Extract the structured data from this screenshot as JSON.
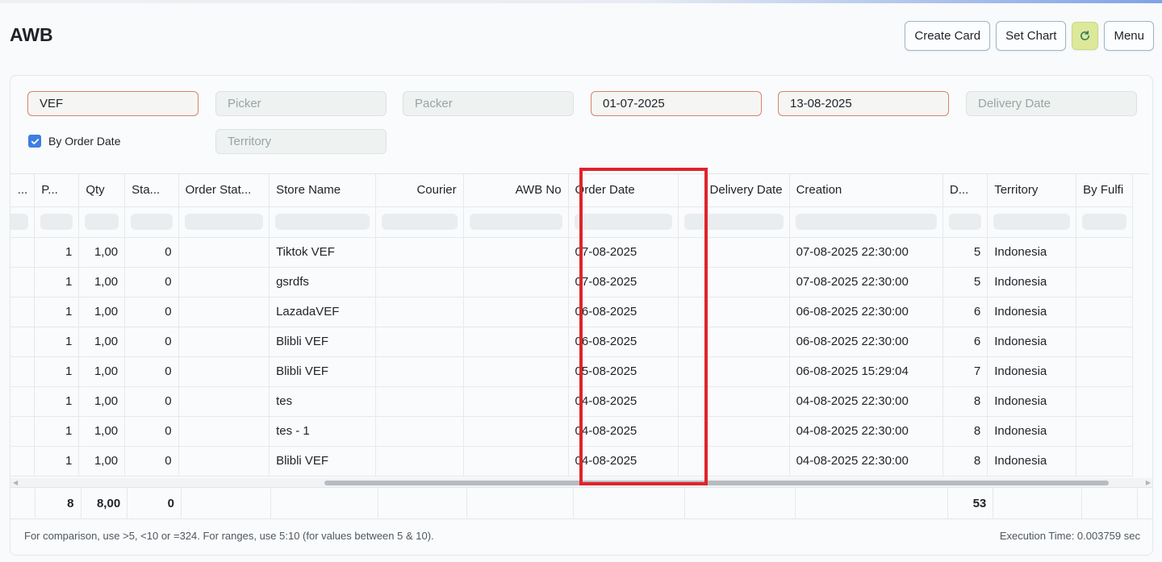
{
  "page": {
    "title": "AWB",
    "actions": {
      "create_card": "Create Card",
      "set_chart": "Set Chart",
      "refresh_icon": "refresh-icon",
      "menu": "Menu"
    }
  },
  "filters": {
    "company": {
      "value": "VEF",
      "placeholder": ""
    },
    "picker": {
      "value": "",
      "placeholder": "Picker"
    },
    "packer": {
      "value": "",
      "placeholder": "Packer"
    },
    "from_date": {
      "value": "01-07-2025",
      "placeholder": ""
    },
    "to_date": {
      "value": "13-08-2025",
      "placeholder": ""
    },
    "delivery_date": {
      "value": "",
      "placeholder": "Delivery Date"
    },
    "by_order_date": {
      "label": "By Order Date",
      "checked": true
    },
    "territory": {
      "value": "",
      "placeholder": "Territory"
    }
  },
  "table": {
    "columns": [
      {
        "label": "...",
        "align": "right"
      },
      {
        "label": "P...",
        "align": "left"
      },
      {
        "label": "Qty",
        "align": "left"
      },
      {
        "label": "Sta...",
        "align": "left"
      },
      {
        "label": "Order Stat...",
        "align": "left"
      },
      {
        "label": "Store Name",
        "align": "left"
      },
      {
        "label": "Courier",
        "align": "right"
      },
      {
        "label": "AWB No",
        "align": "right"
      },
      {
        "label": "Order Date",
        "align": "left"
      },
      {
        "label": "Delivery Date",
        "align": "right"
      },
      {
        "label": "Creation",
        "align": "left"
      },
      {
        "label": "D...",
        "align": "left"
      },
      {
        "label": "Territory",
        "align": "left"
      },
      {
        "label": "By Fulfi",
        "align": "left"
      }
    ],
    "rows": [
      [
        "",
        "1",
        "1,00",
        "0",
        "",
        "Tiktok VEF",
        "",
        "",
        "07-08-2025",
        "",
        "07-08-2025 22:30:00",
        "5",
        "Indonesia",
        ""
      ],
      [
        "",
        "1",
        "1,00",
        "0",
        "",
        "gsrdfs",
        "",
        "",
        "07-08-2025",
        "",
        "07-08-2025 22:30:00",
        "5",
        "Indonesia",
        ""
      ],
      [
        "",
        "1",
        "1,00",
        "0",
        "",
        "LazadaVEF",
        "",
        "",
        "06-08-2025",
        "",
        "06-08-2025 22:30:00",
        "6",
        "Indonesia",
        ""
      ],
      [
        "",
        "1",
        "1,00",
        "0",
        "",
        "Blibli VEF",
        "",
        "",
        "06-08-2025",
        "",
        "06-08-2025 22:30:00",
        "6",
        "Indonesia",
        ""
      ],
      [
        "",
        "1",
        "1,00",
        "0",
        "",
        "Blibli VEF",
        "",
        "",
        "05-08-2025",
        "",
        "06-08-2025 15:29:04",
        "7",
        "Indonesia",
        ""
      ],
      [
        "",
        "1",
        "1,00",
        "0",
        "",
        "tes",
        "",
        "",
        "04-08-2025",
        "",
        "04-08-2025 22:30:00",
        "8",
        "Indonesia",
        ""
      ],
      [
        "",
        "1",
        "1,00",
        "0",
        "",
        "tes - 1",
        "",
        "",
        "04-08-2025",
        "",
        "04-08-2025 22:30:00",
        "8",
        "Indonesia",
        ""
      ],
      [
        "",
        "1",
        "1,00",
        "0",
        "",
        "Blibli VEF",
        "",
        "",
        "04-08-2025",
        "",
        "04-08-2025 22:30:00",
        "8",
        "Indonesia",
        ""
      ]
    ],
    "totals": [
      "",
      "8",
      "8,00",
      "0",
      "",
      "",
      "",
      "",
      "",
      "",
      "",
      "53",
      "",
      ""
    ]
  },
  "footer": {
    "hint": "For comparison, use >5, <10 or =324. For ranges, use 5:10 (for values between 5 & 10).",
    "execution_time": "Execution Time: 0.003759 sec"
  },
  "colors": {
    "highlight": "#e0232b",
    "refresh_button": "#dde89a",
    "checkbox": "#3d7ee0",
    "filled_field_border": "#d9826a"
  }
}
